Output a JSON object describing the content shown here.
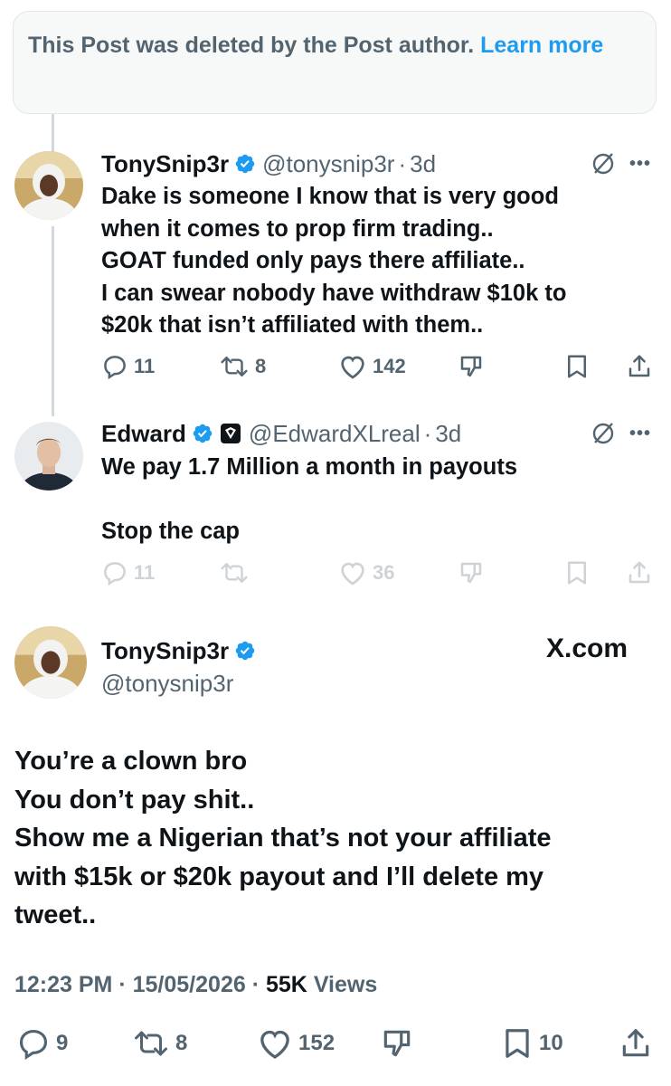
{
  "deleted_notice": {
    "text": "This Post was deleted by the Post author.",
    "link": "Learn more"
  },
  "reply1": {
    "name": "TonySnip3r",
    "handle": "@tonysnip3r",
    "time": "3d",
    "body": "Dake is someone I know that is very good\nwhen it comes to prop firm trading..\nGOAT funded only pays there affiliate..\nI can swear nobody have withdraw $10k to\n$20k that isn’t affiliated with them..",
    "replies": "11",
    "reposts": "8",
    "likes": "142"
  },
  "reply2": {
    "name": "Edward",
    "handle": "@EdwardXLreal",
    "time": "3d",
    "body": "We pay 1.7 Million a month in payouts\n\nStop the cap",
    "replies": "11",
    "reposts": "",
    "likes": "36"
  },
  "main_post": {
    "name": "TonySnip3r",
    "handle": "@tonysnip3r",
    "brand": "X.com",
    "body": "You’re a clown bro\nYou don’t pay shit..\nShow me a Nigerian that’s not your affiliate\nwith $15k or $20k payout and I’ll delete my\ntweet..",
    "time": "12:23 PM",
    "date": "15/05/2026",
    "views_count": "55K",
    "views_label": "Views",
    "replies": "9",
    "reposts": "8",
    "likes": "152",
    "bookmarks": "10"
  },
  "icons": {
    "verified": "verified-badge-icon",
    "reply": "reply-icon",
    "repost": "repost-icon",
    "like": "heart-icon",
    "dislike": "downvote-icon",
    "bookmark": "bookmark-icon",
    "share": "share-icon",
    "grok": "grok-icon",
    "more": "more-icon"
  },
  "colors": {
    "accent": "#1d9bf0",
    "text": "#0f1419",
    "muted": "#536471",
    "thread_line": "#cfd9de"
  }
}
